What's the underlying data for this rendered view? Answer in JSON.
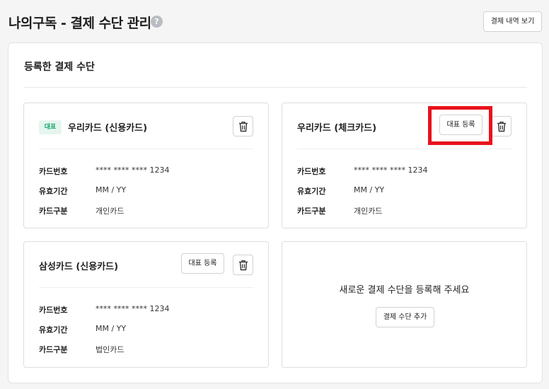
{
  "header": {
    "title": "나의구독 - 결제 수단 관리",
    "help_icon": "question-circle-icon",
    "history_button": "결제 내역 보기"
  },
  "section": {
    "title": "등록한 결제 수단"
  },
  "labels": {
    "card_number": "카드번호",
    "expiry": "유효기간",
    "card_type": "카드구분"
  },
  "cards": [
    {
      "badge": "대표",
      "name": "우리카드 (신용카드)",
      "number": "**** **** **** 1234",
      "expiry": "MM / YY",
      "type": "개인카드"
    },
    {
      "name": "우리카드 (체크카드)",
      "rep_button": "대표 등록",
      "number": "**** **** **** 1234",
      "expiry": "MM / YY",
      "type": "개인카드"
    },
    {
      "name": "삼성카드 (신용카드)",
      "rep_button": "대표 등록",
      "number": "**** **** **** 1234",
      "expiry": "MM / YY",
      "type": "법인카드"
    }
  ],
  "add_card": {
    "message": "새로운 결제 수단을 등록해 주세요",
    "button": "결제 수단 추가"
  },
  "colors": {
    "badge_bg": "#e5f6ef",
    "badge_text": "#15a36a",
    "highlight": "#e8111a"
  }
}
